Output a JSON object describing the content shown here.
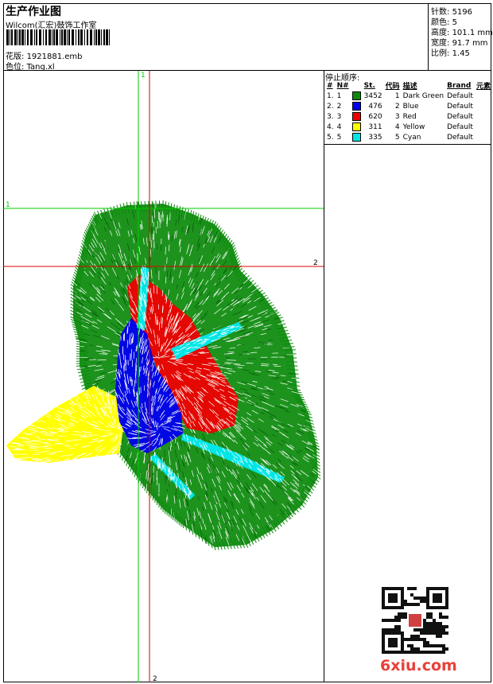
{
  "header": {
    "title": "生产作业图",
    "company": "Wilcom(汇宏)鼓饰工作室",
    "design_label": "花版:",
    "design_file": "1921881.emb",
    "color_label": "色位:",
    "color_file": "Tang.xl"
  },
  "stats": [
    {
      "label": "针数:",
      "value": "5196"
    },
    {
      "label": "颜色:",
      "value": "5"
    },
    {
      "label": "高度:",
      "value": "101.1 mm"
    },
    {
      "label": "宽度:",
      "value": "91.7 mm"
    },
    {
      "label": "比例:",
      "value": "1.45"
    }
  ],
  "stop_sequence": {
    "heading": "停止顺序:",
    "columns": [
      "#",
      "N#",
      "St.",
      "代码",
      "描述",
      "Brand",
      "元素"
    ],
    "rows": [
      {
        "index": "1.",
        "n": "1",
        "color": "#0a8a0a",
        "stitches": "3452",
        "code": "1",
        "description": "Dark Green",
        "brand": "Default"
      },
      {
        "index": "2.",
        "n": "2",
        "color": "#0000ee",
        "stitches": "476",
        "code": "2",
        "description": "Blue",
        "brand": "Default"
      },
      {
        "index": "3.",
        "n": "3",
        "color": "#ee0000",
        "stitches": "620",
        "code": "3",
        "description": "Red",
        "brand": "Default"
      },
      {
        "index": "4.",
        "n": "4",
        "color": "#ffff00",
        "stitches": "311",
        "code": "4",
        "description": "Yellow",
        "brand": "Default"
      },
      {
        "index": "5.",
        "n": "5",
        "color": "#00e6e6",
        "stitches": "335",
        "code": "5",
        "description": "Cyan",
        "brand": "Default"
      }
    ]
  },
  "guides": {
    "green_vertical": "1",
    "green_horizontal": "1",
    "red_vertical": "2",
    "red_horizontal": "2",
    "green_color": "#00cc00",
    "red_color": "#dd0000"
  },
  "watermark": "6xiu.com"
}
